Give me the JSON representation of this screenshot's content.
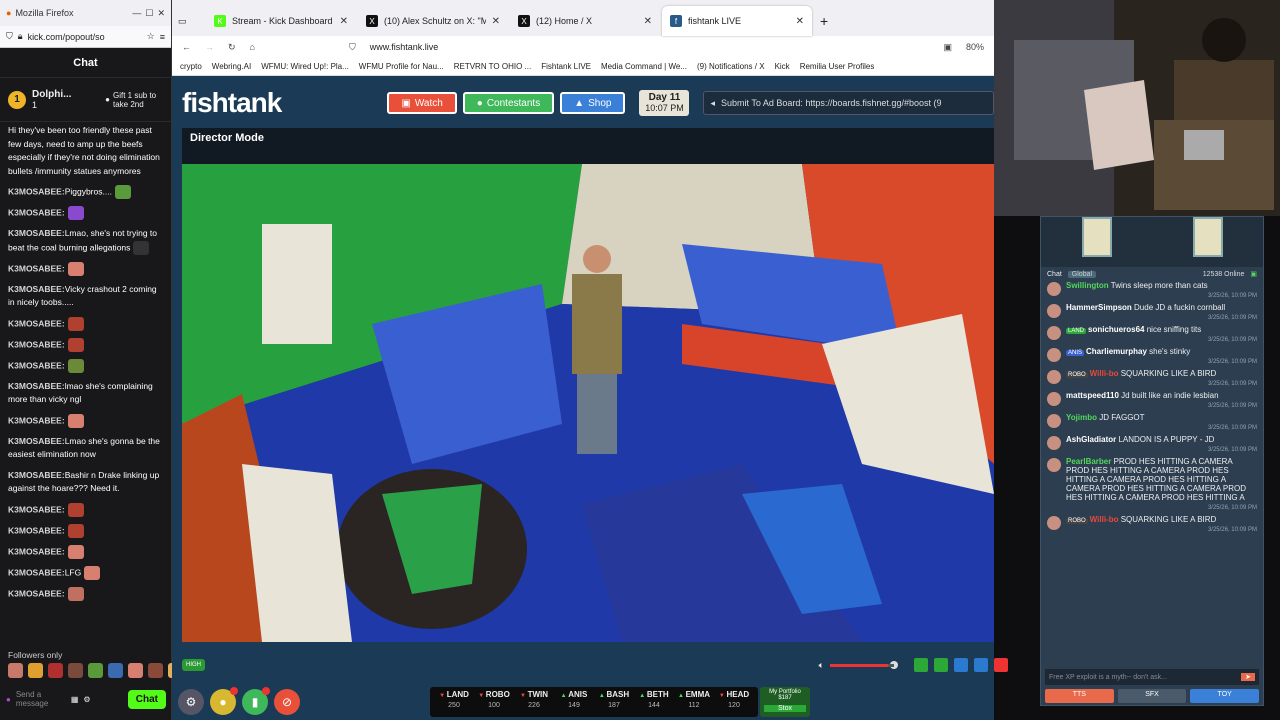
{
  "left": {
    "window_title": "Mozilla Firefox",
    "url": "kick.com/popout/so",
    "chat_title": "Chat",
    "pinned": {
      "rank": "1",
      "name": "Dolphi...",
      "sub": "1",
      "gift": "Gift 1 sub to take 2nd"
    },
    "messages": [
      {
        "u": "",
        "t": "Hi they've been too friendly these past few days, need to amp up the beefs especially if they're not doing elimination bullets /immunity statues anymores",
        "emo": ""
      },
      {
        "u": "K3MOSABEE:",
        "t": "Piggybros....",
        "emo": "#5a9a3a"
      },
      {
        "u": "K3MOSABEE:",
        "t": "",
        "emo": "#8a4ad0"
      },
      {
        "u": "K3MOSABEE:",
        "t": "Lmao, she's not trying to beat the coal burning allegations",
        "emo": "#333"
      },
      {
        "u": "K3MOSABEE:",
        "t": "",
        "emo": "#d88070"
      },
      {
        "u": "K3MOSABEE:",
        "t": "Vicky crashout 2 coming in nicely toobs.....",
        "emo": ""
      },
      {
        "u": "K3MOSABEE:",
        "t": "",
        "emo": "#b04030"
      },
      {
        "u": "K3MOSABEE:",
        "t": "",
        "emo": "#b04030"
      },
      {
        "u": "K3MOSABEE:",
        "t": "",
        "emo": "#6a8a3a"
      },
      {
        "u": "K3MOSABEE:",
        "t": "lmao she's complaining more than vicky ngl",
        "emo": ""
      },
      {
        "u": "K3MOSABEE:",
        "t": "",
        "emo": "#d88070"
      },
      {
        "u": "K3MOSABEE:",
        "t": "Lmao she's gonna be the easiest elimination now",
        "emo": ""
      },
      {
        "u": "K3MOSABEE:",
        "t": "Bashir n Drake linking up against the hoare??? Need it.",
        "emo": ""
      },
      {
        "u": "K3MOSABEE:",
        "t": "",
        "emo": "#b04030"
      },
      {
        "u": "K3MOSABEE:",
        "t": "",
        "emo": "#b04030"
      },
      {
        "u": "K3MOSABEE:",
        "t": "",
        "emo": "#d88070"
      },
      {
        "u": "K3MOSABEE:",
        "t": "LFG",
        "emo": "#d88070"
      },
      {
        "u": "K3MOSABEE:",
        "t": "",
        "emo": "#c07060"
      }
    ],
    "followers": "Followers only",
    "input_placeholder": "Send a message",
    "chat_button": "Chat"
  },
  "tabs": [
    {
      "label": "Stream - Kick Dashboard",
      "color": "#53fc18",
      "icon": "K"
    },
    {
      "label": "(10) Alex Schultz on X: \"My New",
      "color": "#111",
      "icon": "X"
    },
    {
      "label": "(12) Home / X",
      "color": "#111",
      "icon": "X"
    },
    {
      "label": "fishtank LIVE",
      "color": "#2a5a8a",
      "icon": "f"
    }
  ],
  "nav": {
    "url": "www.fishtank.live",
    "zoom": "80%"
  },
  "bookmarks": [
    "crypto",
    "Webring.AI",
    "WFMU: Wired Up!: Pla...",
    "WFMU Profile for Nau...",
    "RETVRN TO OHIO ...",
    "Fishtank LIVE",
    "Media Command | We...",
    "(9) Notifications / X",
    "Kick",
    "Remilia User Profiles"
  ],
  "fishtank": {
    "logo": "fishtank",
    "watch": "Watch",
    "contestants": "Contestants",
    "shop": "Shop",
    "day": "Day 11",
    "time": "10:07 PM",
    "adboard": "Submit To Ad Board: https://boards.fishnet.gg/#boost (9",
    "director": "Director Mode",
    "quality": "HIGH",
    "volume": 0.9
  },
  "contestants": [
    {
      "name": "LAND",
      "dir": "down",
      "val": "250",
      "color": "#e74c3c"
    },
    {
      "name": "ROBO",
      "dir": "down",
      "val": "100",
      "color": "#e74c3c"
    },
    {
      "name": "TWIN",
      "dir": "down",
      "val": "226",
      "color": "#e74c3c"
    },
    {
      "name": "ANIS",
      "dir": "up",
      "val": "149",
      "color": "#53d85b"
    },
    {
      "name": "BASH",
      "dir": "up",
      "val": "187",
      "color": "#53d85b"
    },
    {
      "name": "BETH",
      "dir": "up",
      "val": "144",
      "color": "#53d85b"
    },
    {
      "name": "EMMA",
      "dir": "up",
      "val": "112",
      "color": "#53d85b"
    },
    {
      "name": "HEAD",
      "dir": "down",
      "val": "120",
      "color": "#e74c3c"
    }
  ],
  "portfolio": {
    "title": "My Portfolio",
    "value": "$187",
    "label": "Stox"
  },
  "right": {
    "chat_label": "Chat",
    "global": "Global",
    "online": "12538 Online",
    "messages": [
      {
        "u": "Swillington",
        "c": "#53d85b",
        "t": "Twins sleep more than cats",
        "ts": "3/25/26, 10:09 PM",
        "badge": ""
      },
      {
        "u": "HammerSimpson",
        "c": "#fff",
        "t": "Dude JD a fuckin cornball",
        "ts": "3/25/26, 10:09 PM",
        "badge": ""
      },
      {
        "u": "sonichueros64",
        "c": "#fff",
        "t": "nice sniffing tits",
        "ts": "3/25/26, 10:09 PM",
        "badge": "LAND"
      },
      {
        "u": "Charliemurphay",
        "c": "#fff",
        "t": "she's stinky",
        "ts": "3/25/26, 10:09 PM",
        "badge": "ANIS"
      },
      {
        "u": "Willi-bo",
        "c": "#e84a3a",
        "t": "SQUARKING LIKE A BIRD",
        "ts": "3/25/26, 10:09 PM",
        "badge": "ROBO"
      },
      {
        "u": "mattspeed110",
        "c": "#fff",
        "t": "Jd built like an indie lesbian",
        "ts": "3/25/26, 10:09 PM",
        "badge": ""
      },
      {
        "u": "Yojimbo",
        "c": "#53d85b",
        "t": "JD FAGGOT",
        "ts": "3/25/26, 10:09 PM",
        "badge": ""
      },
      {
        "u": "AshGladiator",
        "c": "#fff",
        "t": "LANDON IS A PUPPY - JD",
        "ts": "3/25/26, 10:09 PM",
        "badge": ""
      },
      {
        "u": "PearlBarber",
        "c": "#53d85b",
        "t": "PROD HES HITTING A CAMERA PROD HES HITTING A CAMERA PROD HES HITTING A CAMERA PROD HES HITTING A CAMERA PROD HES HITTING A CAMERA PROD HES HITTING A CAMERA PROD HES HITTING A",
        "ts": "3/25/26, 10:09 PM",
        "badge": ""
      },
      {
        "u": "Willi-bo",
        "c": "#e84a3a",
        "t": "SQUARKING LIKE A BIRD",
        "ts": "3/25/26, 10:09 PM",
        "badge": "ROBO"
      }
    ],
    "input_placeholder": "Free XP exploit is a myth-- don't ask...",
    "tts": "TTS",
    "sfx": "SFX",
    "toy": "TOY"
  }
}
